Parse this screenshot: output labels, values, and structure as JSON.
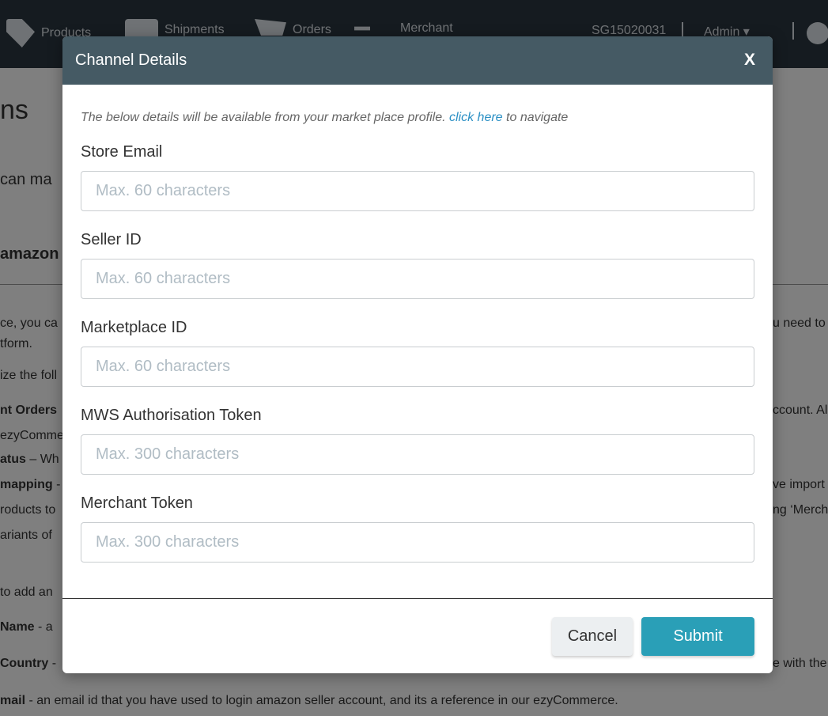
{
  "navbar": {
    "products_label": "Products",
    "shipments_label": "Shipments",
    "orders_label": "Orders",
    "merchant_label": "Merchant",
    "store_code": "SG15020031",
    "user_label": "Admin ▾",
    "icons": [
      "tag-icon",
      "truck-icon",
      "cart-icon",
      "merchant-icon",
      "user-icon",
      "gear-icon"
    ]
  },
  "background_page": {
    "title_fragment": "ns",
    "intro_fragment": "can ma",
    "channel_fragment": "amazon",
    "lines": {
      "l1_left": "ce, you ca",
      "l1_right": "u need to",
      "l2_left": "tform.",
      "l3_left": "ize the foll",
      "l4_left_bold": "nt Orders",
      "l4_right": "ccount. Al",
      "l5_left": "ezyComme",
      "l6_left_bold": "atus",
      "l6_left_rest": " – Wh",
      "l7_left_bold": "mapping",
      "l7_left_rest": " -",
      "l7_right": "ve import",
      "l8_left": "roducts to",
      "l8_right": "ng ‘Merch",
      "l9_left": "ariants of",
      "l10_left": "to add an",
      "l11_left_bold": "Name",
      "l11_left_rest": " - a",
      "l12_left_bold": "Country",
      "l12_left_rest": " -",
      "l12_right": "e with the",
      "l13_bold": "mail",
      "l13_rest": " - an email id that you have used to login amazon seller account, and its a reference in our ezyCommerce."
    }
  },
  "modal": {
    "title": "Channel Details",
    "close_label": "X",
    "intro_text": "The below details will be available from your market place profile.",
    "intro_link": "click here",
    "intro_suffix": "to navigate",
    "fields": [
      {
        "label": "Store Email",
        "placeholder": "Max. 60 characters",
        "value": ""
      },
      {
        "label": "Seller ID",
        "placeholder": "Max. 60 characters",
        "value": ""
      },
      {
        "label": "Marketplace ID",
        "placeholder": "Max. 60 characters",
        "value": ""
      },
      {
        "label": "MWS Authorisation Token",
        "placeholder": "Max. 300 characters",
        "value": ""
      },
      {
        "label": "Merchant Token",
        "placeholder": "Max. 300 characters",
        "value": ""
      }
    ],
    "cancel_label": "Cancel",
    "submit_label": "Submit"
  },
  "colors": {
    "navbar_bg": "#2b3740",
    "modal_header_bg": "#455a64",
    "link": "#2a8fc4",
    "submit_bg": "#2a9fb7",
    "cancel_bg": "#eceff1"
  }
}
